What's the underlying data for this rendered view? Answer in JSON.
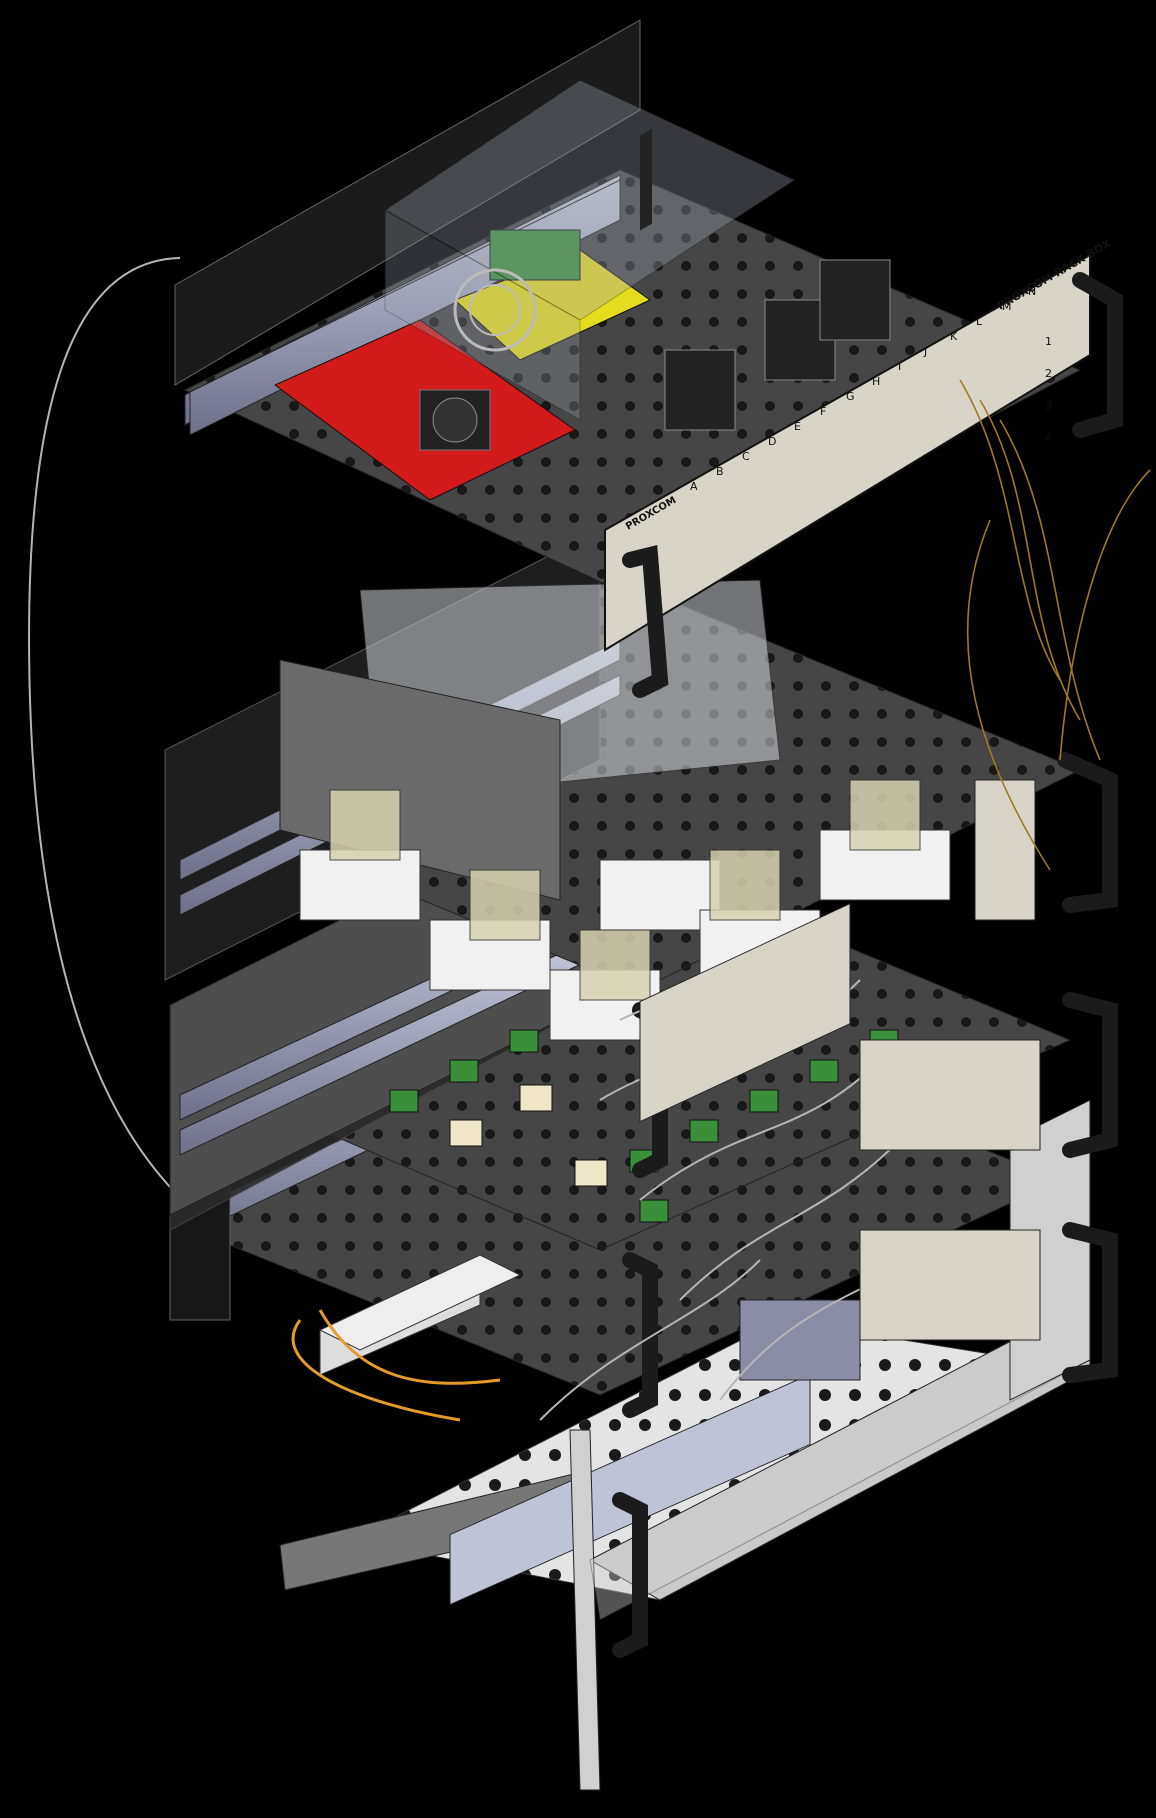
{
  "panel": {
    "label": "PROXCOM RACK BOX",
    "side_label": "PROXCOM"
  },
  "columns": [
    "A",
    "B",
    "C",
    "D",
    "E",
    "F",
    "G",
    "H",
    "I",
    "J",
    "K",
    "L",
    "M",
    "N"
  ],
  "rows": [
    "1",
    "2",
    "3",
    "4"
  ],
  "colors": {
    "background": "#000000",
    "panel_face": "#d8d5c8",
    "frame_rail": "#9ea2b8",
    "pcb_red": "#d21a1a",
    "pcb_yellow": "#e6dc1e",
    "pcb_green": "#3a8f3a",
    "cable_gray": "#b5b5b5",
    "cable_orange": "#e59a2a",
    "wire_brown": "#a07828",
    "plate_gray": "#4a4a4a",
    "handle_black": "#1b1b1b"
  }
}
